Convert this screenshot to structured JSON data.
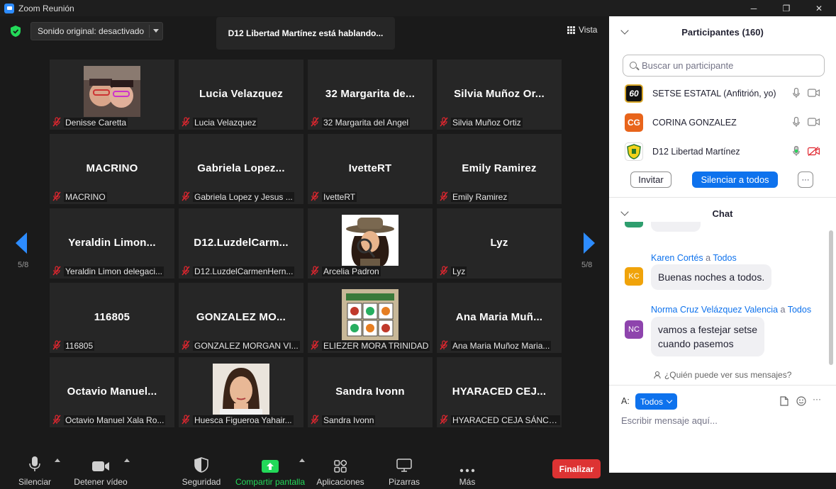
{
  "window": {
    "title": "Zoom Reunión",
    "controls": [
      "─",
      "❐",
      "✕"
    ]
  },
  "top": {
    "sound_label": "Sonido original: desactivado",
    "speaking_banner": "D12 Libertad Martínez está hablando...",
    "view_label": "Vista"
  },
  "pagination": {
    "left": "5/8",
    "right": "5/8"
  },
  "tiles": [
    {
      "big": "",
      "label": "Denisse Caretta"
    },
    {
      "big": "Lucia Velazquez",
      "label": "Lucia Velazquez"
    },
    {
      "big": "32  Margarita de...",
      "label": "32 Margarita del Angel"
    },
    {
      "big": "Silvia  Muñoz  Or...",
      "label": "Silvia Muñoz Ortiz"
    },
    {
      "big": "MACRINO",
      "label": "MACRINO"
    },
    {
      "big": "Gabriela  Lopez...",
      "label": "Gabriela Lopez  y Jesus ..."
    },
    {
      "big": "IvetteRT",
      "label": "IvetteRT"
    },
    {
      "big": "Emily Ramirez",
      "label": "Emily Ramirez"
    },
    {
      "big": "Yeraldin  Limon...",
      "label": "Yeraldin Limon delegaci..."
    },
    {
      "big": "D12.LuzdelCarm...",
      "label": "D12.LuzdelCarmenHern..."
    },
    {
      "big": "",
      "label": "Arcelia Padron"
    },
    {
      "big": "Lyz",
      "label": "Lyz"
    },
    {
      "big": "116805",
      "label": "116805"
    },
    {
      "big": "GONZALEZ  MO...",
      "label": "GONZALEZ MORGAN VI..."
    },
    {
      "big": "",
      "label": "ELIEZER MORA TRINIDAD"
    },
    {
      "big": "Ana Maria  Muñ...",
      "label": "Ana Maria Muñoz Maria..."
    },
    {
      "big": "Octavio  Manuel...",
      "label": "Octavio Manuel Xala Ro..."
    },
    {
      "big": "",
      "label": "Huesca Figueroa Yahair..."
    },
    {
      "big": "Sandra Ivonn",
      "label": "Sandra Ivonn"
    },
    {
      "big": "HYARACED  CEJ...",
      "label": "HYARACED CEJA SÁNCH..."
    }
  ],
  "toolbar": {
    "mute": "Silenciar",
    "video": "Detener vídeo",
    "security": "Seguridad",
    "share": "Compartir pantalla",
    "apps": "Aplicaciones",
    "boards": "Pizarras",
    "more": "Más",
    "end": "Finalizar"
  },
  "participants": {
    "title": "Participantes (160)",
    "search_placeholder": "Buscar un participante",
    "list": [
      {
        "avatar": "60",
        "name": "SETSE ESTATAL (Anfitrión, yo)",
        "color": "#111111"
      },
      {
        "avatar": "CG",
        "name": "CORINA GONZALEZ",
        "color": "#e8641b"
      },
      {
        "avatar": "",
        "name": "D12 Libertad Martínez",
        "color": "#f3d21b"
      }
    ],
    "invite": "Invitar",
    "mute_all": "Silenciar a todos",
    "more": "···"
  },
  "chat": {
    "title": "Chat",
    "messages": [
      {
        "avatar": "KC",
        "avatar_color": "#f0a30a",
        "sender": "Karen Cortés",
        "a": "a",
        "to": "Todos",
        "text": "Buenas noches a todos."
      },
      {
        "avatar": "NC",
        "avatar_color": "#8e44ad",
        "sender": "Norma Cruz Velázquez Valencia",
        "a": "a",
        "to": "Todos",
        "line1": "vamos a festejar setse",
        "line2": "cuando pasemos"
      }
    ],
    "who_can_see": "¿Quién puede ver sus mensajes?",
    "to_label": "A:",
    "to_value": "Todos",
    "compose_placeholder": "Escribir mensaje aquí...",
    "compose_more": "···"
  }
}
